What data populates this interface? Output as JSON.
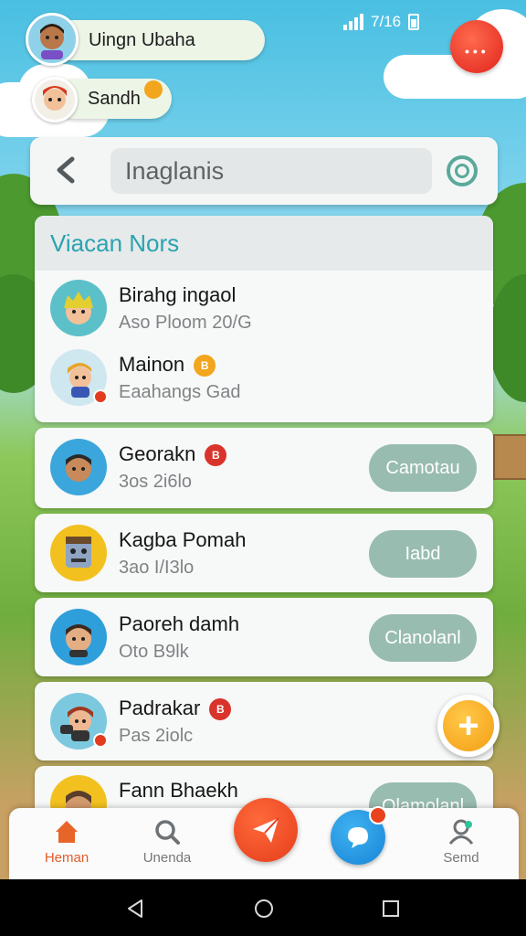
{
  "status_bar": {
    "text": "7/16"
  },
  "profiles": [
    {
      "name": "Uingn Ubaha"
    },
    {
      "name": "Sandh"
    }
  ],
  "search": {
    "placeholder": "Inaglanis"
  },
  "section": {
    "title": "Viacan Nors"
  },
  "contacts": [
    {
      "name": "Birahg ingaol",
      "sub": "Aso Ploom 20/G",
      "badge": "",
      "action": ""
    },
    {
      "name": "Mainon",
      "sub": "Eaahangs Gad",
      "badge": "B",
      "action": ""
    },
    {
      "name": "Georakn",
      "sub": "3os 2i6lo",
      "badge": "B",
      "action": "Camotau"
    },
    {
      "name": "Kagba Pomah",
      "sub": "3ao I/I3lo",
      "badge": "",
      "action": "Iabd"
    },
    {
      "name": "Paoreh damh",
      "sub": "Oto B9lk",
      "badge": "",
      "action": "Clanolanl"
    },
    {
      "name": "Padrakar",
      "sub": "Pas 2iolc",
      "badge": "B",
      "action": ""
    },
    {
      "name": "Fann Bhaekh",
      "sub": "",
      "badge": "",
      "action": "Olamolanl"
    }
  ],
  "fab": {
    "label": "+"
  },
  "bottom_nav": [
    {
      "label": "Heman",
      "icon": "home-icon",
      "active": true
    },
    {
      "label": "Unenda",
      "icon": "search-icon",
      "active": false
    },
    {
      "label": "",
      "icon": "send-icon",
      "active": false
    },
    {
      "label": "",
      "icon": "chat-icon",
      "active": false
    },
    {
      "label": "Semd",
      "icon": "person-icon",
      "active": false
    }
  ],
  "colors": {
    "accent_teal": "#2aa3b2",
    "pill": "#98bcb0",
    "active_orange": "#e25b2a",
    "fab_yellow": "#f49d12",
    "send_red": "#e53d1c",
    "chat_blue": "#1784d8"
  }
}
